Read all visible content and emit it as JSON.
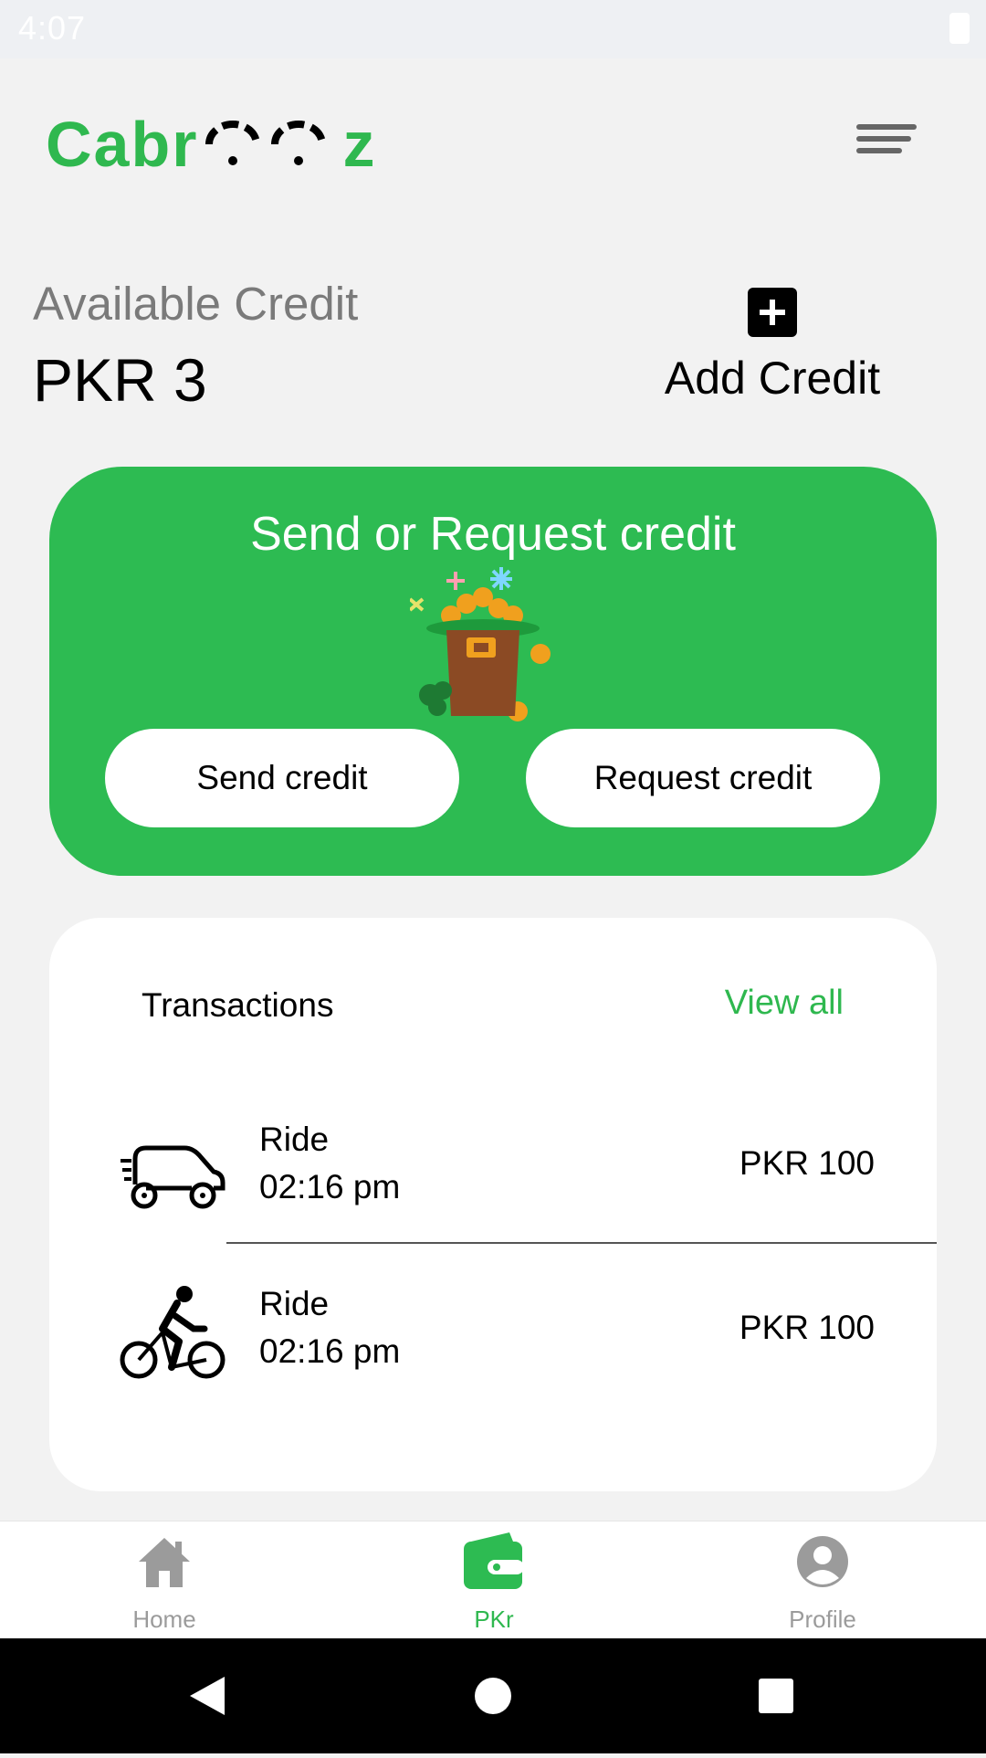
{
  "status_bar": {
    "time": "4:07"
  },
  "header": {
    "logo_text_start": "Cabr",
    "logo_text_end": "z"
  },
  "credit": {
    "label": "Available Credit",
    "value": "PKR 3",
    "add_label": "Add Credit"
  },
  "send_card": {
    "title": "Send or Request credit",
    "send_label": "Send credit",
    "request_label": "Request credit"
  },
  "transactions": {
    "title": "Transactions",
    "view_all": "View all",
    "items": [
      {
        "icon": "car-icon",
        "title": "Ride",
        "time": "02:16 pm",
        "amount": "PKR 100"
      },
      {
        "icon": "bicycle-icon",
        "title": "Ride",
        "time": "02:16 pm",
        "amount": "PKR 100"
      }
    ]
  },
  "bottom_nav": {
    "items": [
      {
        "label": "Home",
        "icon": "home-icon",
        "active": false
      },
      {
        "label": "PKr",
        "icon": "wallet-icon",
        "active": true
      },
      {
        "label": "Profile",
        "icon": "profile-icon",
        "active": false
      }
    ]
  },
  "colors": {
    "brand_green": "#2dbb52",
    "inactive_gray": "#9b9b9b",
    "background": "#f2f2f2"
  }
}
